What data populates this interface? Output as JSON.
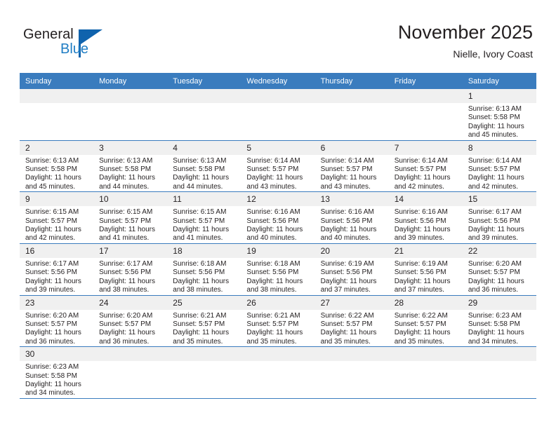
{
  "brand": {
    "name_part1": "General",
    "name_part2": "Blue",
    "logo_icon": "triangle-flag-icon",
    "color_dark": "#231f20",
    "color_blue": "#1f7dc4",
    "color_triangle": "#1063ad"
  },
  "header": {
    "month_title": "November 2025",
    "location": "Nielle, Ivory Coast"
  },
  "theme": {
    "header_row_bg": "#3a7cbe",
    "header_row_text": "#ffffff",
    "daynum_bg": "#f0f0f0",
    "row_separator": "#3a7cbe",
    "body_text": "#231f20"
  },
  "calendar": {
    "weekday_headers": [
      "Sunday",
      "Monday",
      "Tuesday",
      "Wednesday",
      "Thursday",
      "Friday",
      "Saturday"
    ],
    "weeks": [
      [
        {
          "day": "",
          "lines": []
        },
        {
          "day": "",
          "lines": []
        },
        {
          "day": "",
          "lines": []
        },
        {
          "day": "",
          "lines": []
        },
        {
          "day": "",
          "lines": []
        },
        {
          "day": "",
          "lines": []
        },
        {
          "day": "1",
          "lines": [
            "Sunrise: 6:13 AM",
            "Sunset: 5:58 PM",
            "Daylight: 11 hours and 45 minutes."
          ]
        }
      ],
      [
        {
          "day": "2",
          "lines": [
            "Sunrise: 6:13 AM",
            "Sunset: 5:58 PM",
            "Daylight: 11 hours and 45 minutes."
          ]
        },
        {
          "day": "3",
          "lines": [
            "Sunrise: 6:13 AM",
            "Sunset: 5:58 PM",
            "Daylight: 11 hours and 44 minutes."
          ]
        },
        {
          "day": "4",
          "lines": [
            "Sunrise: 6:13 AM",
            "Sunset: 5:58 PM",
            "Daylight: 11 hours and 44 minutes."
          ]
        },
        {
          "day": "5",
          "lines": [
            "Sunrise: 6:14 AM",
            "Sunset: 5:57 PM",
            "Daylight: 11 hours and 43 minutes."
          ]
        },
        {
          "day": "6",
          "lines": [
            "Sunrise: 6:14 AM",
            "Sunset: 5:57 PM",
            "Daylight: 11 hours and 43 minutes."
          ]
        },
        {
          "day": "7",
          "lines": [
            "Sunrise: 6:14 AM",
            "Sunset: 5:57 PM",
            "Daylight: 11 hours and 42 minutes."
          ]
        },
        {
          "day": "8",
          "lines": [
            "Sunrise: 6:14 AM",
            "Sunset: 5:57 PM",
            "Daylight: 11 hours and 42 minutes."
          ]
        }
      ],
      [
        {
          "day": "9",
          "lines": [
            "Sunrise: 6:15 AM",
            "Sunset: 5:57 PM",
            "Daylight: 11 hours and 42 minutes."
          ]
        },
        {
          "day": "10",
          "lines": [
            "Sunrise: 6:15 AM",
            "Sunset: 5:57 PM",
            "Daylight: 11 hours and 41 minutes."
          ]
        },
        {
          "day": "11",
          "lines": [
            "Sunrise: 6:15 AM",
            "Sunset: 5:57 PM",
            "Daylight: 11 hours and 41 minutes."
          ]
        },
        {
          "day": "12",
          "lines": [
            "Sunrise: 6:16 AM",
            "Sunset: 5:56 PM",
            "Daylight: 11 hours and 40 minutes."
          ]
        },
        {
          "day": "13",
          "lines": [
            "Sunrise: 6:16 AM",
            "Sunset: 5:56 PM",
            "Daylight: 11 hours and 40 minutes."
          ]
        },
        {
          "day": "14",
          "lines": [
            "Sunrise: 6:16 AM",
            "Sunset: 5:56 PM",
            "Daylight: 11 hours and 39 minutes."
          ]
        },
        {
          "day": "15",
          "lines": [
            "Sunrise: 6:17 AM",
            "Sunset: 5:56 PM",
            "Daylight: 11 hours and 39 minutes."
          ]
        }
      ],
      [
        {
          "day": "16",
          "lines": [
            "Sunrise: 6:17 AM",
            "Sunset: 5:56 PM",
            "Daylight: 11 hours and 39 minutes."
          ]
        },
        {
          "day": "17",
          "lines": [
            "Sunrise: 6:17 AM",
            "Sunset: 5:56 PM",
            "Daylight: 11 hours and 38 minutes."
          ]
        },
        {
          "day": "18",
          "lines": [
            "Sunrise: 6:18 AM",
            "Sunset: 5:56 PM",
            "Daylight: 11 hours and 38 minutes."
          ]
        },
        {
          "day": "19",
          "lines": [
            "Sunrise: 6:18 AM",
            "Sunset: 5:56 PM",
            "Daylight: 11 hours and 38 minutes."
          ]
        },
        {
          "day": "20",
          "lines": [
            "Sunrise: 6:19 AM",
            "Sunset: 5:56 PM",
            "Daylight: 11 hours and 37 minutes."
          ]
        },
        {
          "day": "21",
          "lines": [
            "Sunrise: 6:19 AM",
            "Sunset: 5:56 PM",
            "Daylight: 11 hours and 37 minutes."
          ]
        },
        {
          "day": "22",
          "lines": [
            "Sunrise: 6:20 AM",
            "Sunset: 5:57 PM",
            "Daylight: 11 hours and 36 minutes."
          ]
        }
      ],
      [
        {
          "day": "23",
          "lines": [
            "Sunrise: 6:20 AM",
            "Sunset: 5:57 PM",
            "Daylight: 11 hours and 36 minutes."
          ]
        },
        {
          "day": "24",
          "lines": [
            "Sunrise: 6:20 AM",
            "Sunset: 5:57 PM",
            "Daylight: 11 hours and 36 minutes."
          ]
        },
        {
          "day": "25",
          "lines": [
            "Sunrise: 6:21 AM",
            "Sunset: 5:57 PM",
            "Daylight: 11 hours and 35 minutes."
          ]
        },
        {
          "day": "26",
          "lines": [
            "Sunrise: 6:21 AM",
            "Sunset: 5:57 PM",
            "Daylight: 11 hours and 35 minutes."
          ]
        },
        {
          "day": "27",
          "lines": [
            "Sunrise: 6:22 AM",
            "Sunset: 5:57 PM",
            "Daylight: 11 hours and 35 minutes."
          ]
        },
        {
          "day": "28",
          "lines": [
            "Sunrise: 6:22 AM",
            "Sunset: 5:57 PM",
            "Daylight: 11 hours and 35 minutes."
          ]
        },
        {
          "day": "29",
          "lines": [
            "Sunrise: 6:23 AM",
            "Sunset: 5:58 PM",
            "Daylight: 11 hours and 34 minutes."
          ]
        }
      ],
      [
        {
          "day": "30",
          "lines": [
            "Sunrise: 6:23 AM",
            "Sunset: 5:58 PM",
            "Daylight: 11 hours and 34 minutes."
          ]
        },
        {
          "day": "",
          "lines": []
        },
        {
          "day": "",
          "lines": []
        },
        {
          "day": "",
          "lines": []
        },
        {
          "day": "",
          "lines": []
        },
        {
          "day": "",
          "lines": []
        },
        {
          "day": "",
          "lines": []
        }
      ]
    ]
  }
}
